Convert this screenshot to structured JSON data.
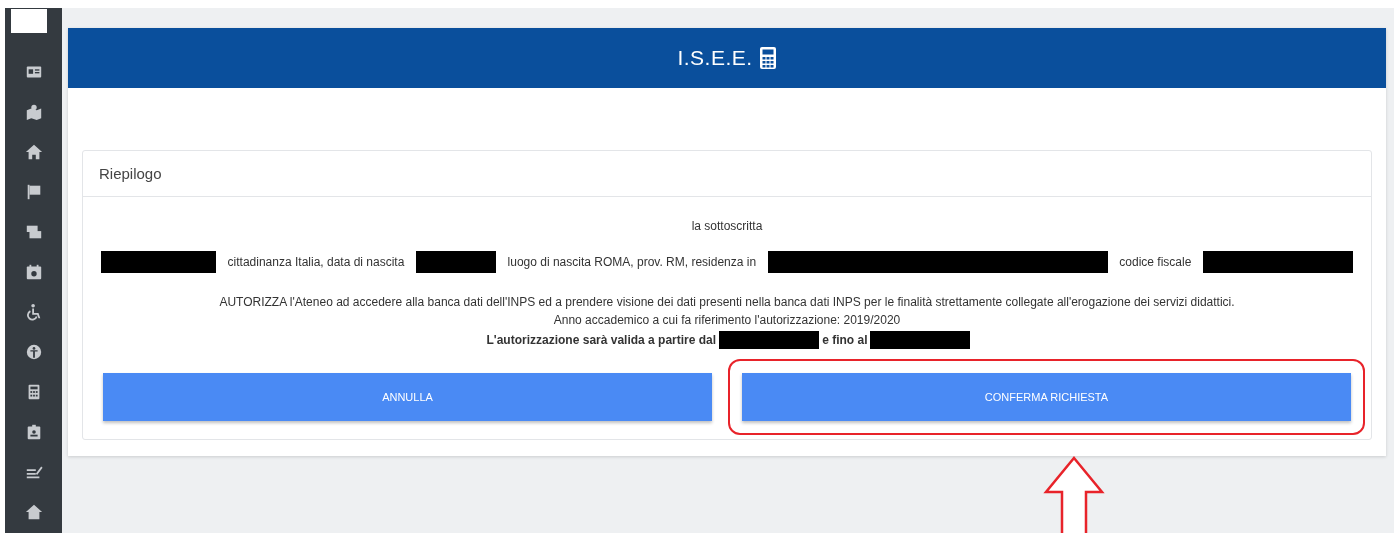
{
  "header": {
    "title": "I.S.E.E."
  },
  "card": {
    "title": "Riepilogo",
    "intro": "la sottoscritta",
    "details": [
      {
        "kind": "redacted"
      },
      {
        "kind": "text",
        "text": "cittadinanza Italia, data di nascita"
      },
      {
        "kind": "redacted"
      },
      {
        "kind": "text",
        "text": "luogo di nascita ROMA, prov. RM, residenza in"
      },
      {
        "kind": "redacted"
      },
      {
        "kind": "text",
        "text": "codice fiscale"
      },
      {
        "kind": "redacted"
      }
    ],
    "authorization": "AUTORIZZA l'Ateneo ad accedere alla banca dati dell'INPS ed a prendere visione dei dati presenti nella banca dati INPS per le finalità strettamente collegate all'erogazione dei servizi didattici.",
    "academic_year": "Anno accademico a cui fa riferimento l'autorizzazione: 2019/2020",
    "validity": [
      {
        "kind": "text",
        "text": "L'autorizzazione sarà valida a partire dal"
      },
      {
        "kind": "redacted"
      },
      {
        "kind": "text",
        "text": "e fino al"
      },
      {
        "kind": "redacted"
      }
    ],
    "buttons": [
      {
        "label": "ANNULLA",
        "highlighted": false
      },
      {
        "label": "CONFERMA RICHIESTA",
        "highlighted": true
      }
    ]
  }
}
